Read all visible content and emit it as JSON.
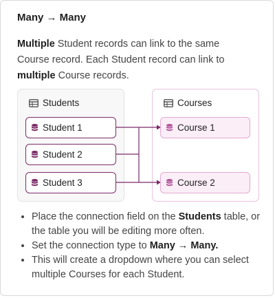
{
  "title": "Many → Many",
  "description": {
    "p1_bold": "Multiple",
    "p1_rest": " Student records can link to the same Course record. Each Student record can link to ",
    "p2_bold": "multiple",
    "p2_rest": " Course records."
  },
  "students_panel": {
    "title": "Students",
    "records": [
      "Student 1",
      "Student 2",
      "Student 3"
    ]
  },
  "courses_panel": {
    "title": "Courses",
    "records": [
      "Course 1",
      "Course 2"
    ]
  },
  "bullets": {
    "b1_pre": "Place the connection field on the ",
    "b1_bold": "Students",
    "b1_post": " table, or the table you will be editing more often.",
    "b2_pre": "Set the connection type to ",
    "b2_bold": "Many → Many.",
    "b3": "This will create a dropdown where you can select multiple Courses for each Student."
  },
  "colors": {
    "student_border": "#7b2a67",
    "course_fill": "#fbeef7",
    "course_border": "#e3a9d2",
    "connector": "#7b2a67"
  }
}
